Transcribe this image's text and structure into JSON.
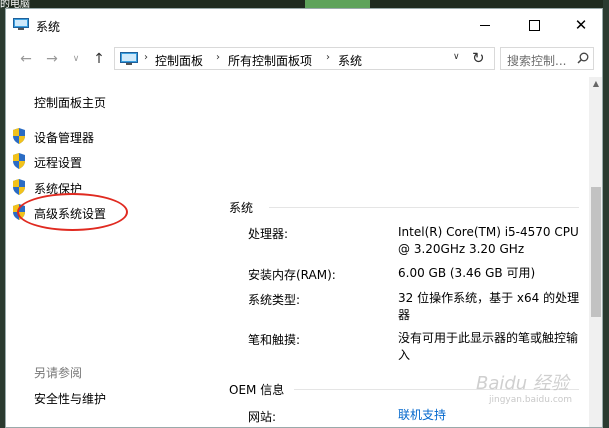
{
  "desktop": {
    "fragment": "的电脑"
  },
  "window": {
    "title": "系统",
    "controls": {
      "minimize": "minimize",
      "maximize": "maximize",
      "close": "✕"
    }
  },
  "nav": {
    "back_icon": "arrow-left-icon",
    "forward_icon": "arrow-right-icon",
    "up_icon": "arrow-up-icon",
    "breadcrumb": [
      "控制面板",
      "所有控制面板项",
      "系统"
    ],
    "search_placeholder": "搜索控制..."
  },
  "sidebar": {
    "home": "控制面板主页",
    "items": [
      {
        "label": "设备管理器",
        "icon": "shield-icon"
      },
      {
        "label": "远程设置",
        "icon": "shield-icon"
      },
      {
        "label": "系统保护",
        "icon": "shield-icon"
      },
      {
        "label": "高级系统设置",
        "icon": "shield-icon",
        "highlighted": true
      }
    ],
    "see_also": "另请参阅",
    "see_also_links": [
      "安全性与维护"
    ]
  },
  "main": {
    "system_section": "系统",
    "props": [
      {
        "label": "处理器:",
        "value": "Intel(R) Core(TM) i5-4570 CPU @ 3.20GHz   3.20 GHz"
      },
      {
        "label": "安装内存(RAM):",
        "value": "6.00 GB (3.46 GB 可用)"
      },
      {
        "label": "系统类型:",
        "value": "32 位操作系统，基于 x64 的处理器"
      },
      {
        "label": "笔和触摸:",
        "value": "没有可用于此显示器的笔或触控输入"
      }
    ],
    "oem_section": "OEM 信息",
    "oem_props": [
      {
        "label": "网站:",
        "value": "联机支持"
      }
    ]
  },
  "watermark": {
    "brand": "Baidu 经验",
    "url": "jingyan.baidu.com"
  },
  "colors": {
    "link": "#0066cc",
    "highlight_ring": "#e02a20",
    "shield_blue": "#2b6cc4",
    "shield_yellow": "#f2c21b"
  }
}
